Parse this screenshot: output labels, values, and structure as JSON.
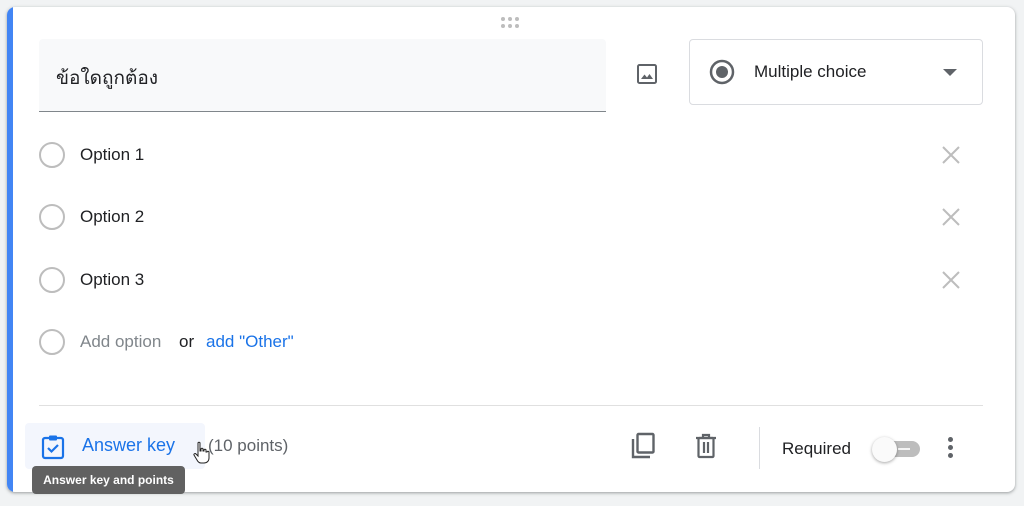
{
  "question": {
    "title": "ข้อใดถูกต้อง",
    "type_selector": {
      "selected": "Multiple choice",
      "icon": "radio-checked-icon"
    }
  },
  "options": [
    {
      "label": "Option 1"
    },
    {
      "label": "Option 2"
    },
    {
      "label": "Option 3"
    }
  ],
  "add_option": {
    "label": "Add option",
    "or_text": "or",
    "add_other_label": "add \"Other\""
  },
  "footer": {
    "answer_key_label": "Answer key",
    "points": "(10 points)",
    "tooltip": "Answer key and points",
    "required_label": "Required",
    "required_on": false
  },
  "colors": {
    "accent": "#4285f4",
    "link": "#1a73e8"
  }
}
